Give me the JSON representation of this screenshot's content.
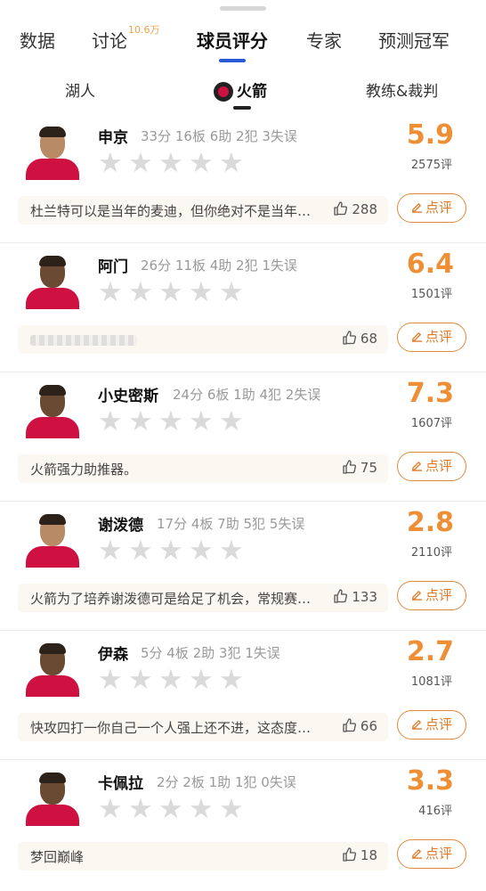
{
  "tabs": [
    {
      "label": "数据"
    },
    {
      "label": "讨论",
      "badge": "10.6万"
    },
    {
      "label": "球员评分"
    },
    {
      "label": "专家"
    },
    {
      "label": "预测冠军"
    }
  ],
  "subtabs": [
    {
      "label": "湖人"
    },
    {
      "label": "火箭"
    },
    {
      "label": "教练&裁判"
    }
  ],
  "review_label": "点评",
  "colors": {
    "accent": "#ee8f35",
    "jersey": "#ce1141",
    "tab_indicator": "#2a5bd7"
  },
  "players": [
    {
      "name": "申京",
      "stats": "33分 16板 6助 2犯 3失误",
      "score": "5.9",
      "count": "2575评",
      "comment": "杜兰特可以是当年的麦迪，但你绝对不是当年…",
      "likes": "288",
      "rating": 0
    },
    {
      "name": "阿门",
      "stats": "26分 11板 4助 2犯 1失误",
      "score": "6.4",
      "count": "1501评",
      "comment": "",
      "likes": "68",
      "rating": 0
    },
    {
      "name": "小史密斯",
      "stats": "24分 6板 1助 4犯 2失误",
      "score": "7.3",
      "count": "1607评",
      "comment": "火箭强力助推器。",
      "likes": "75",
      "rating": 0
    },
    {
      "name": "谢泼德",
      "stats": "17分 4板 7助 5犯 5失误",
      "score": "2.8",
      "count": "2110评",
      "comment": "火箭为了培养谢泼德可是给足了机会，常规赛…",
      "likes": "133",
      "rating": 0
    },
    {
      "name": "伊森",
      "stats": "5分 4板 2助 3犯 1失误",
      "score": "2.7",
      "count": "1081评",
      "comment": "快攻四打一你自己一个人强上还不进，这态度…",
      "likes": "66",
      "rating": 0
    },
    {
      "name": "卡佩拉",
      "stats": "2分 2板 1助 1犯 0失误",
      "score": "3.3",
      "count": "416评",
      "comment": "梦回巅峰",
      "likes": "18",
      "rating": 0
    }
  ]
}
